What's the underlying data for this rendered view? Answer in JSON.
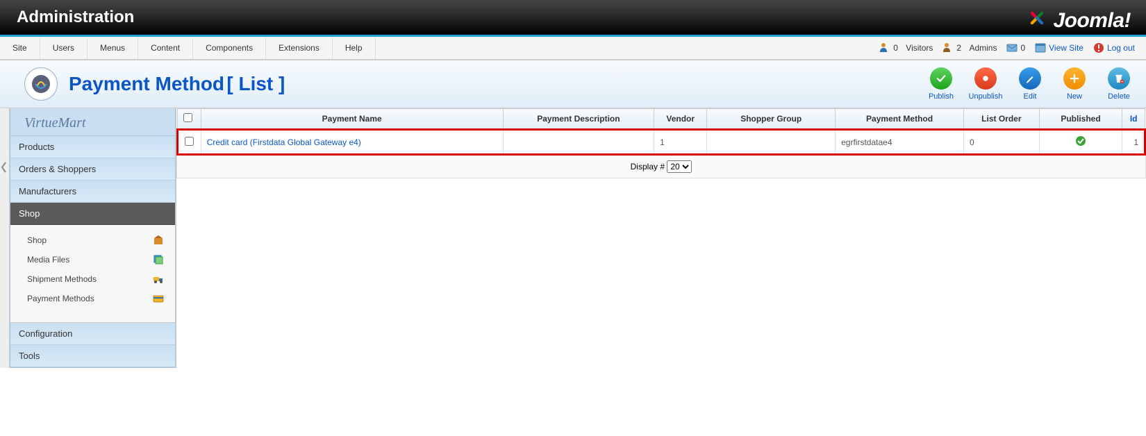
{
  "header": {
    "title": "Administration",
    "brand": "Joomla!"
  },
  "menu": {
    "items": [
      "Site",
      "Users",
      "Menus",
      "Content",
      "Components",
      "Extensions",
      "Help"
    ],
    "status": {
      "visitors_count": "0",
      "visitors_label": "Visitors",
      "admins_count": "2",
      "admins_label": "Admins",
      "messages_count": "0",
      "view_site": "View Site",
      "log_out": "Log out"
    }
  },
  "page": {
    "title": "Payment Method",
    "suffix": "[ List ]"
  },
  "toolbar": {
    "publish": "Publish",
    "unpublish": "Unpublish",
    "edit": "Edit",
    "new": "New",
    "delete": "Delete"
  },
  "sidebar": {
    "brand": "VirtueMart",
    "sections": [
      "Products",
      "Orders & Shoppers",
      "Manufacturers"
    ],
    "active": "Shop",
    "shop_items": [
      "Shop",
      "Media Files",
      "Shipment Methods",
      "Payment Methods"
    ],
    "tail": [
      "Configuration",
      "Tools"
    ]
  },
  "table": {
    "headers": {
      "name": "Payment Name",
      "desc": "Payment Description",
      "vendor": "Vendor",
      "group": "Shopper Group",
      "method": "Payment Method",
      "order": "List Order",
      "published": "Published",
      "id": "Id"
    },
    "rows": [
      {
        "name": "Credit card (Firstdata Global Gateway e4)",
        "desc": "",
        "vendor": "1",
        "group": "",
        "method": "egrfirstdatae4",
        "order": "0",
        "published": true,
        "id": "1"
      }
    ],
    "display_label": "Display #",
    "display_value": "20"
  }
}
